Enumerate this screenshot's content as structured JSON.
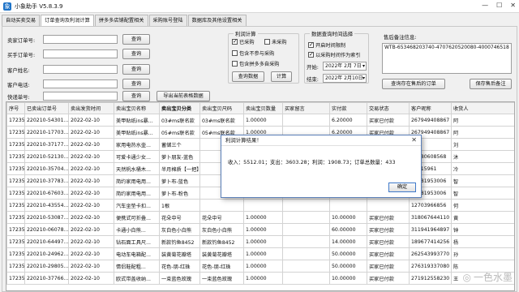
{
  "window": {
    "title": "小象助手 V5.8.3.9",
    "minimize": "—",
    "maximize": "☐",
    "close": "✕"
  },
  "tabs": [
    "自动买卖交易",
    "订单查询及利润计算",
    "拼多多店铺配置相关",
    "采购账号登陆",
    "数据库及其他设置相关"
  ],
  "active_tab": 1,
  "form": {
    "seller_order_label": "卖家订单号:",
    "buyer_order_label": "买手订单号:",
    "customer_name_label": "客户姓名:",
    "customer_phone_label": "客户电话:",
    "tracking_label": "快递单号:",
    "query_button": "查询",
    "export_button": "导出当前表格数据"
  },
  "profit": {
    "title": "利润计算",
    "purchased": "已采购",
    "not_purchased": "未采购",
    "include_non_purchase": "包含不参与采购",
    "include_pdd_partial": "包含拼多多自采购",
    "query_data_button": "查询数据",
    "calc_button": "计算"
  },
  "date_filter": {
    "title": "数据查询时间选择",
    "enable_time_limit": "开启时间限制",
    "use_purchase_time": "以采购时间作为索引",
    "start_label": "开始:",
    "start_value": "2022年 2月 7日",
    "end_label": "结束:",
    "end_value": "2022年 2月10日"
  },
  "after_sale": {
    "label": "售后备注信息:",
    "value": "WTB-653468203740-4707620520080-4000746518",
    "query_button": "查询存在售后的订单",
    "save_button": "保存售后备注"
  },
  "table": {
    "headers": [
      "序号",
      "已卖出订单号",
      "卖出发货时间",
      "卖出宝贝名称",
      "卖出宝贝分类",
      "卖出宝贝尺码",
      "卖出宝贝数量",
      "买家留言",
      "实付款",
      "交易状态",
      "客户昵称",
      "收货人"
    ],
    "bold_header_index": 4,
    "rows": [
      [
        "17235",
        "220210-54301...",
        "2022-02-10",
        "美甲贴纸ins暴...",
        "03#ms联名款",
        "03#ms联名款",
        "1.00000",
        "",
        "6.20000",
        "买家已付款",
        "267949408867",
        "阿"
      ],
      [
        "17235",
        "220210-17703...",
        "2022-02-10",
        "美甲贴纸ins暴...",
        "05#ms联名款",
        "05#ms联名款",
        "1.00000",
        "",
        "6.20000",
        "买家已付款",
        "267949408867",
        "阿"
      ],
      [
        "17235",
        "220210-37177...",
        "2022-02-10",
        "家用电热水壶...",
        "蓄储三个",
        "",
        "",
        "",
        "",
        "",
        "280",
        "刘"
      ],
      [
        "17235",
        "220210-52130...",
        "2022-02-10",
        "可爱卡通少女...",
        "萝卜朋友-蓝色",
        "",
        "",
        "",
        "",
        "",
        "98980608568",
        "沐"
      ],
      [
        "17235",
        "220210-35704...",
        "2022-02-10",
        "天然帆水桶木...",
        "半月棉质【一把】",
        "",
        "",
        "",
        "",
        "",
        "62815961",
        "冷"
      ],
      [
        "17235",
        "220210-37783...",
        "2022-02-10",
        "简约家用电用...",
        "萝卜布-蓝色",
        "",
        "",
        "",
        "",
        "",
        "72681953006",
        "智"
      ],
      [
        "17235",
        "220210-67603...",
        "2022-02-10",
        "简约家用电用...",
        "萝卜布-粉色",
        "",
        "",
        "",
        "",
        "",
        "72681953006",
        "智"
      ],
      [
        "17235",
        "220210-43554...",
        "2022-02-10",
        "汽车坐垫卡扣...",
        "1根",
        "",
        "",
        "",
        "",
        "",
        "12703966856",
        "何"
      ],
      [
        "17235",
        "220210-53087...",
        "2022-02-10",
        "便携式可折叠...",
        "花朵中号",
        "花朵中号",
        "1.00000",
        "",
        "10.00000",
        "买家已付款",
        "318067644110",
        "黄"
      ],
      [
        "17235",
        "220210-06078...",
        "2022-02-10",
        "卡通小白熊...",
        "灰白色小白熊",
        "灰白色小白熊",
        "1.00000",
        "",
        "60.00000",
        "买家已付款",
        "311941964897",
        "钟"
      ],
      [
        "17235",
        "220210-64497...",
        "2022-02-10",
        "钻石面工具尺...",
        "新款钓鱼8452",
        "新款钓鱼8452",
        "1.00000",
        "",
        "14.00000",
        "买家已付款",
        "189677414256",
        "杨"
      ],
      [
        "17235",
        "220210-24962...",
        "2022-02-10",
        "电动车电箱配...",
        "装黄菊花瓣塔",
        "装黄菊花瓣塔",
        "1.00000",
        "",
        "50.00000",
        "买家已付款",
        "262543993770",
        "孙"
      ],
      [
        "17235",
        "220210-29805...",
        "2022-02-10",
        "情侣鞋配粗...",
        "花色-朋-红珠",
        "花色-朋-红珠",
        "1.00000",
        "",
        "50.00000",
        "买家已付款",
        "276319337080",
        "陈"
      ],
      [
        "17235",
        "220210-37766...",
        "2022-02-10",
        "欧式带盖收纳...",
        "一束蓝色玫瑰",
        "一束蓝色玫瑰",
        "1.00000",
        "",
        "10.00000",
        "买家已付款",
        "271912558230",
        "王"
      ]
    ]
  },
  "dialog": {
    "title": "利润计算结果！",
    "message": "收入：5512.01；支出：3603.28；利润：1908.73；订单总数量：433",
    "ok": "确定",
    "close": "✕"
  },
  "watermark": "一色水墨"
}
